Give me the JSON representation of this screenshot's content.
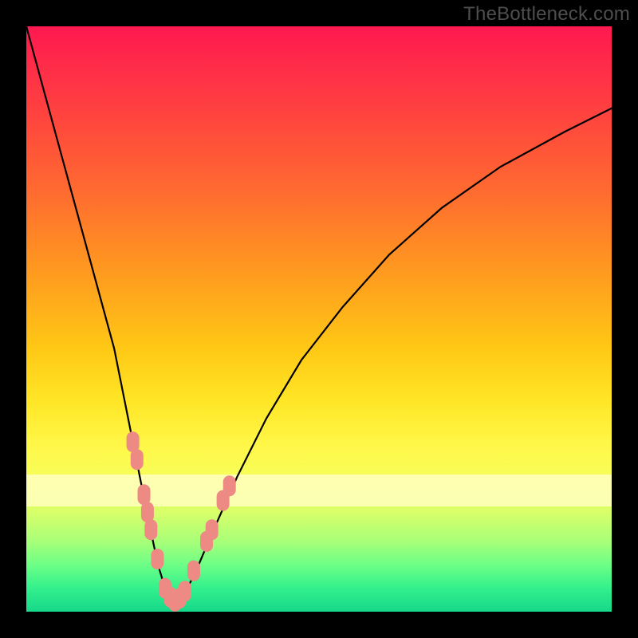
{
  "credit_text": "TheBottleneck.com",
  "colors": {
    "dot_fill": "#ec8a83",
    "curve_stroke": "#000000",
    "frame_bg": "#000000"
  },
  "chart_data": {
    "type": "line",
    "title": "",
    "xlabel": "",
    "ylabel": "",
    "xlim": [
      0,
      100
    ],
    "ylim": [
      0,
      100
    ],
    "grid": false,
    "legend": false,
    "series": [
      {
        "name": "bottleneck-curve",
        "x": [
          0,
          3,
          6,
          9,
          12,
          15,
          17,
          19,
          21,
          22.5,
          24,
          25.5,
          27,
          29,
          32,
          36,
          41,
          47,
          54,
          62,
          71,
          81,
          92,
          100
        ],
        "values": [
          100,
          89,
          78,
          67,
          56,
          45,
          35,
          25,
          15,
          8,
          3,
          1.5,
          3,
          7,
          14,
          23,
          33,
          43,
          52,
          61,
          69,
          76,
          82,
          86
        ]
      }
    ],
    "points": [
      {
        "name": "left-cluster-top",
        "x": 18.2,
        "y": 29
      },
      {
        "name": "left-cluster-upper",
        "x": 18.9,
        "y": 26
      },
      {
        "name": "left-cluster-mid1",
        "x": 20.1,
        "y": 20
      },
      {
        "name": "left-cluster-mid2",
        "x": 20.7,
        "y": 17
      },
      {
        "name": "left-cluster-mid3",
        "x": 21.3,
        "y": 14
      },
      {
        "name": "left-cluster-low",
        "x": 22.4,
        "y": 9
      },
      {
        "name": "trough-a",
        "x": 23.7,
        "y": 4
      },
      {
        "name": "trough-b",
        "x": 24.6,
        "y": 2.5
      },
      {
        "name": "trough-c",
        "x": 25.4,
        "y": 1.8
      },
      {
        "name": "trough-d",
        "x": 26.2,
        "y": 2.3
      },
      {
        "name": "trough-e",
        "x": 27.1,
        "y": 3.5
      },
      {
        "name": "right-cluster-low",
        "x": 28.6,
        "y": 7
      },
      {
        "name": "right-cluster-mid1",
        "x": 30.8,
        "y": 12
      },
      {
        "name": "right-cluster-mid2",
        "x": 31.7,
        "y": 14
      },
      {
        "name": "right-cluster-upper",
        "x": 33.6,
        "y": 19
      },
      {
        "name": "right-cluster-top",
        "x": 34.7,
        "y": 21.5
      }
    ]
  }
}
